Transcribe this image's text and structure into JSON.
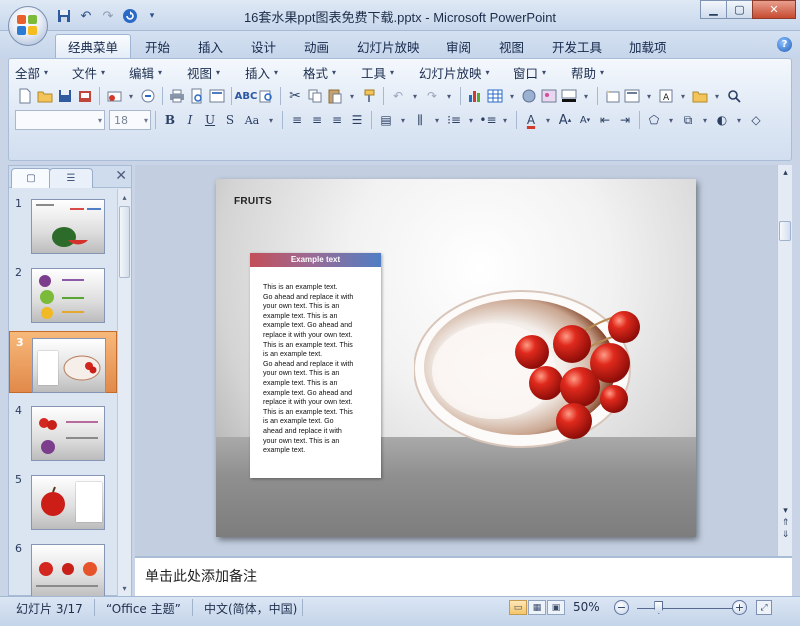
{
  "window": {
    "title": "16套水果ppt图表免费下载.pptx - Microsoft PowerPoint",
    "controls": [
      "minimize-icon",
      "maximize-icon",
      "close-icon"
    ]
  },
  "quick_access": [
    "save-icon",
    "undo-icon",
    "redo-icon",
    "customize-icon"
  ],
  "tabs": [
    {
      "label": "经典菜单",
      "active": true
    },
    {
      "label": "开始"
    },
    {
      "label": "插入"
    },
    {
      "label": "设计"
    },
    {
      "label": "动画"
    },
    {
      "label": "幻灯片放映"
    },
    {
      "label": "审阅"
    },
    {
      "label": "视图"
    },
    {
      "label": "开发工具"
    },
    {
      "label": "加载项"
    }
  ],
  "menus": [
    "全部",
    "文件",
    "编辑",
    "视图",
    "插入",
    "格式",
    "工具",
    "幻灯片放映",
    "窗口",
    "帮助"
  ],
  "font_size": "18",
  "panel": {
    "slides": [
      {
        "num": "1"
      },
      {
        "num": "2"
      },
      {
        "num": "3",
        "active": true
      },
      {
        "num": "4"
      },
      {
        "num": "5"
      },
      {
        "num": "6"
      }
    ]
  },
  "slide": {
    "title": "FRUITS",
    "card_header": "Example text",
    "card_body": "This is an example text.\nGo ahead and replace it with\nyour own text. This is an\nexample text. This is an\nexample text. Go ahead and\nreplace it with your own text.\nThis is an example text. This\nis an example text.\nGo ahead and replace it with\nyour own text. This is an\nexample text. This is an\nexample text. Go ahead and\nreplace it with your own text.\nThis is an example text. This\nis an example text. Go\nahead and replace it with\nyour own text. This is an\nexample text."
  },
  "notes_placeholder": "单击此处添加备注",
  "status": {
    "slide_info": "幻灯片 3/17",
    "theme": "“Office 主题”",
    "language": "中文(简体，中国)",
    "zoom": "50%",
    "zoom_level": 0.5
  }
}
